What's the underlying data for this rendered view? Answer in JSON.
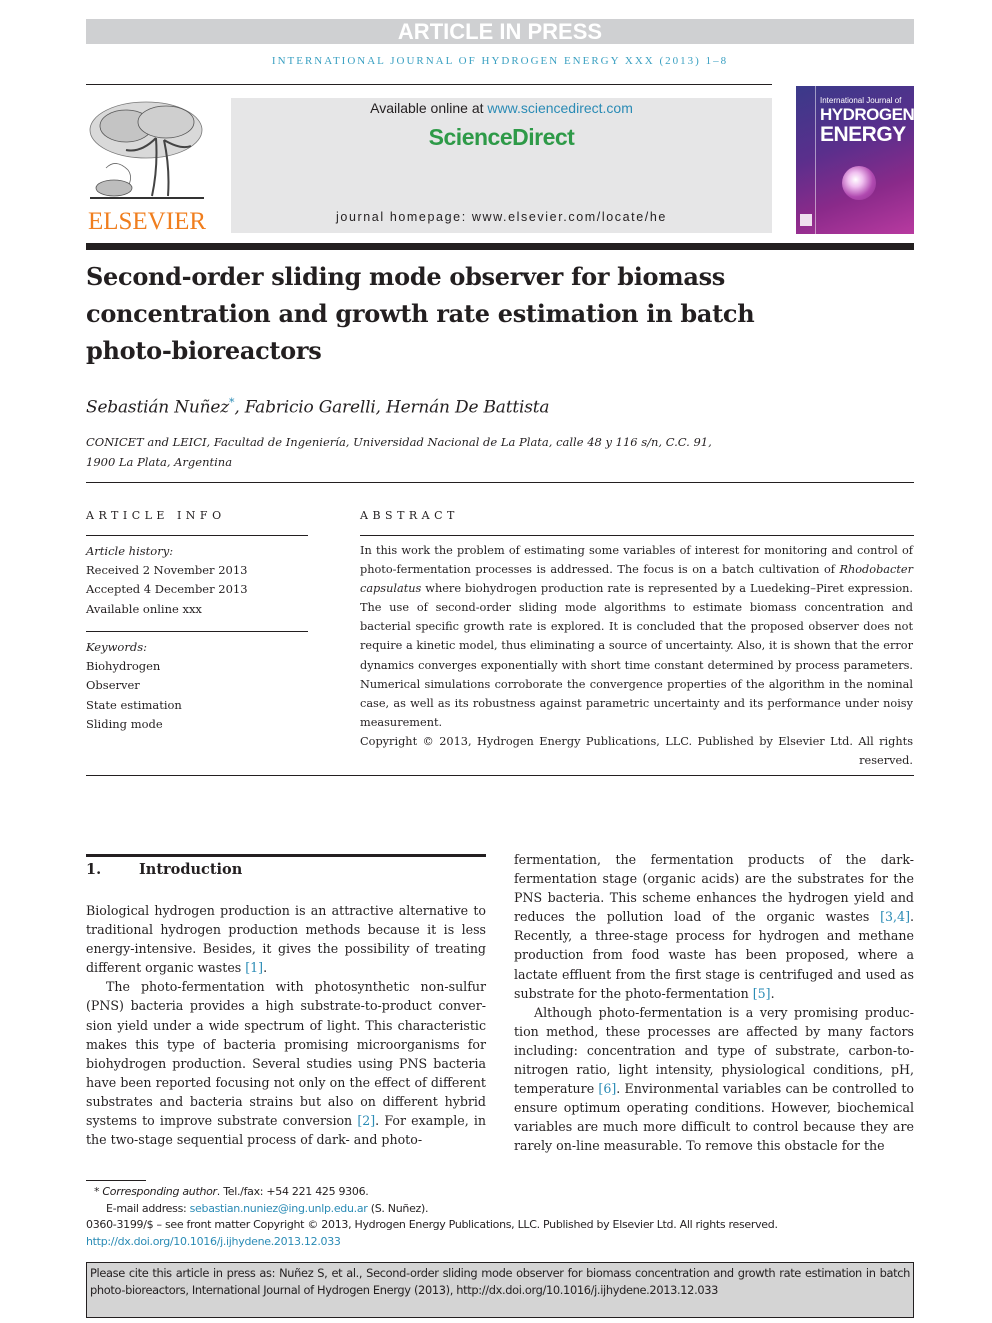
{
  "banner": "ARTICLE IN PRESS",
  "journal_line": "INTERNATIONAL JOURNAL OF HYDROGEN ENERGY XXX (2013) 1–8",
  "header": {
    "publisher_logo": "ELSEVIER",
    "available_prefix": "Available online at ",
    "available_link": "www.sciencedirect.com",
    "brand": "ScienceDirect",
    "homepage": "journal homepage: www.elsevier.com/locate/he",
    "cover": {
      "subtitle": "International Journal of",
      "title_line1": "HYDROGEN",
      "title_line2": "ENERGY"
    }
  },
  "article": {
    "title": "Second-order sliding mode observer for biomass concentration and growth rate estimation in batch photo-bioreactors",
    "authors": [
      {
        "name": "Sebastián Nuñez",
        "mark": "*"
      },
      {
        "name": ", Fabricio Garelli, Hernán De Battista",
        "mark": ""
      }
    ],
    "affiliation_line1": "CONICET and LEICI, Facultad de Ingeniería, Universidad Nacional de La Plata, calle 48 y 116 s/n, C.C. 91,",
    "affiliation_line2": "1900 La Plata, Argentina"
  },
  "article_info": {
    "heading": "ARTICLE INFO",
    "history_label": "Article history:",
    "history": [
      "Received 2 November 2013",
      "Accepted 4 December 2013",
      "Available online xxx"
    ],
    "keywords_label": "Keywords:",
    "keywords": [
      "Biohydrogen",
      "Observer",
      "State estimation",
      "Sliding mode"
    ]
  },
  "abstract": {
    "heading": "ABSTRACT",
    "text_part1": "In this work the problem of estimating some variables of interest for monitoring and control of photo-fermentation processes is addressed. The focus is on a batch cultivation of ",
    "species": "Rhodobacter capsulatus",
    "text_part2": " where biohydrogen production rate is represented by a Luedeking–Piret expression. The use of second-order sliding mode algorithms to estimate biomass concentration and bacterial specific growth rate is explored. It is concluded that the pro­posed observer does not require a kinetic model, thus eliminating a source of uncertainty. Also, it is shown that the error dynamics converges exponentially with short time constant determined by process parameters. Numerical simulations corroborate the convergence properties of the algorithm in the nominal case, as well as its robustness against para­metric uncertainty and its performance under noisy measurement.",
    "copyright": "Copyright © 2013, Hydrogen Energy Publications, LLC. Published by Elsevier Ltd. All rights reserved."
  },
  "section1": {
    "number": "1.",
    "title": "Introduction",
    "left_p1_a": "Biological hydrogen production is an attractive alternative to traditional hydrogen production methods because it is less energy-intensive. Besides, it gives the possibility of treating different organic wastes ",
    "left_p1_ref": "[1]",
    "left_p1_b": ".",
    "left_p2_a": "The photo-fermentation with photosynthetic non-sulfur (PNS) bacteria provides a high substrate-to-product conver­sion yield under a wide spectrum of light. This characteristic makes this type of bacteria promising microorganisms for biohydrogen production. Several studies using PNS bacteria have been reported focusing not only on the effect of different substrates and bacteria strains but also on different hybrid systems to improve substrate conversion ",
    "left_p2_ref": "[2]",
    "left_p2_b": ". For example, in the two-stage sequential process of dark- and photo-",
    "right_p1_a": "fermentation, the fermentation products of the dark-fermentation stage (organic acids) are the substrates for the PNS bacteria. This scheme enhances the hydrogen yield and reduces the pollution load of the organic wastes ",
    "right_p1_ref1": "[3,4]",
    "right_p1_b": ". Recently, a three-stage process for hydrogen and methane production from food waste has been proposed, where a lactate effluent from the first stage is centrifuged and used as substrate for the photo-fermentation ",
    "right_p1_ref2": "[5]",
    "right_p1_c": ".",
    "right_p2_a": "Although photo-fermentation is a very promising produc­tion method, these processes are affected by many factors including: concentration and type of substrate, carbon-to-nitrogen ratio, light intensity, physiological conditions, pH, temperature ",
    "right_p2_ref": "[6]",
    "right_p2_b": ". Environmental variables can be controlled to ensure optimum operating conditions. However, biochemical variables are much more difficult to control because they are rarely on-line measurable. To remove this obstacle for the"
  },
  "footnotes": {
    "mark": "*",
    "corresponding_label": "Corresponding author",
    "corresponding_rest": ". Tel./fax: +54 221 425 9306.",
    "email_label": "E-mail address: ",
    "email": "sebastian.nuniez@ing.unlp.edu.ar",
    "email_suffix": " (S. Nuñez).",
    "front_matter": "0360-3199/$ – see front matter Copyright © 2013, Hydrogen Energy Publications, LLC. Published by Elsevier Ltd. All rights reserved.",
    "doi": "http://dx.doi.org/10.1016/j.ijhydene.2013.12.033"
  },
  "citation_box": "Please cite this article in press as: Nuñez S, et al., Second-order sliding mode observer for biomass concentration and growth rate estimation in batch photo-bioreactors, International Journal of Hydrogen Energy (2013), http://dx.doi.org/10.1016/j.ijhydene.2013.12.033"
}
